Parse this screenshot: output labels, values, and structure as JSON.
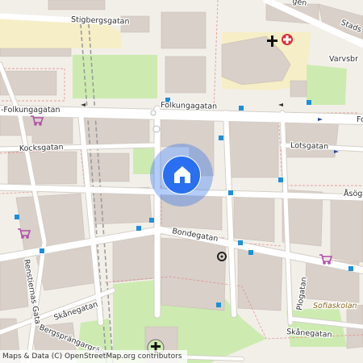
{
  "map": {
    "streets": {
      "stigbergsgatan": "Stigbergsgatan",
      "folkungagatan_left": "-Folkungagatan",
      "folkungagatan_center": "Folkungagatan",
      "folkungagatan_right": "Fo",
      "kocksgatan": "Kocksgatan",
      "lotsgatan": "Lotsgatan",
      "asogatan": "Åsög",
      "bondegatan": "Bondegatan",
      "renstiernas_gata": "Renstiernas Gata",
      "skanegatan_left": "Skånegatan",
      "skanegatan_right": "Skånegatan",
      "bergsprangargrand": "Bergsprängargränd",
      "plogatan": "Plogatan",
      "varvsbr": "Varvsbr",
      "stads": "Stads",
      "top_road": "gen"
    },
    "places": {
      "sofiaskolan": "Sofiaskolan"
    },
    "attribution": "Maps & Data (C) OpenStreetMap.org contributors",
    "colors": {
      "background": "#f2efe9",
      "building": "#d9d0c9",
      "road": "#ffffff",
      "park": "#cdebb0",
      "rail": "#9b9b9b",
      "marker": "#2a6ff0",
      "transit_stop": "#1f8fd8",
      "shop_icon": "#b04fa8",
      "hospital_icon": "#d5333b"
    },
    "icons": [
      "home-icon",
      "church-icon",
      "hospital-icon",
      "shopping-cart-icon",
      "gear-landmark-icon",
      "bus-stop-icon"
    ]
  }
}
